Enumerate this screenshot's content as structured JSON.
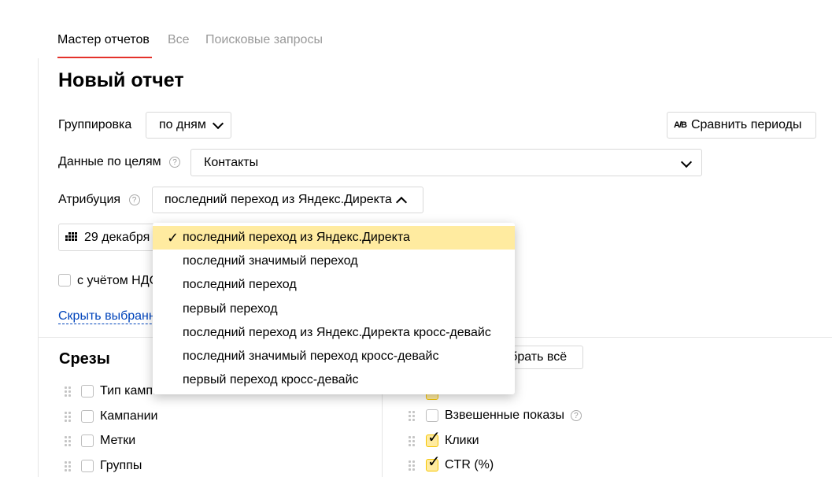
{
  "tabs": [
    {
      "label": "Мастер отчетов"
    },
    {
      "label": "Все"
    },
    {
      "label": "Поисковые запросы"
    }
  ],
  "page_title": "Новый отчет",
  "grouping": {
    "label": "Группировка",
    "value": "по дням"
  },
  "compare_button": {
    "icon_text": "A/B",
    "label": "Сравнить периоды"
  },
  "goals": {
    "label": "Данные по целям",
    "help": "?",
    "value": "Контакты"
  },
  "attribution": {
    "label": "Атрибуция",
    "help": "?",
    "value": "последний переход из Яндекс.Директа"
  },
  "date_button": {
    "label": "29 декабря"
  },
  "vat_checkbox": {
    "label": "с учётом НДС",
    "checked": false
  },
  "hide_link": {
    "label": "Скрыть выбранные"
  },
  "slices": {
    "title": "Срезы",
    "items": [
      {
        "label": "Тип кампании",
        "checked": false
      },
      {
        "label": "Кампании",
        "checked": false
      },
      {
        "label": "Метки",
        "checked": false
      },
      {
        "label": "Группы",
        "checked": false
      }
    ]
  },
  "columns": {
    "select_all_label": "Выбрать всё",
    "items": [
      {
        "label": "Взвешенные показы",
        "checked": false,
        "help": "?"
      },
      {
        "label": "Клики",
        "checked": true
      },
      {
        "label": "CTR (%)",
        "checked": true
      }
    ]
  },
  "attribution_dropdown": {
    "options": [
      {
        "label": "последний переход из Яндекс.Директа",
        "selected": true
      },
      {
        "label": "последний значимый переход",
        "selected": false
      },
      {
        "label": "последний переход",
        "selected": false
      },
      {
        "label": "первый переход",
        "selected": false
      },
      {
        "label": "последний переход из Яндекс.Директа кросс-девайс",
        "selected": false
      },
      {
        "label": "последний значимый переход кросс-девайс",
        "selected": false
      },
      {
        "label": "первый переход кросс-девайс",
        "selected": false
      }
    ]
  },
  "colors": {
    "accent_red": "#e4322b",
    "selected_bg": "#ffeba0",
    "checkbox_yellow": "#f6c500",
    "link_blue": "#0044bb"
  }
}
